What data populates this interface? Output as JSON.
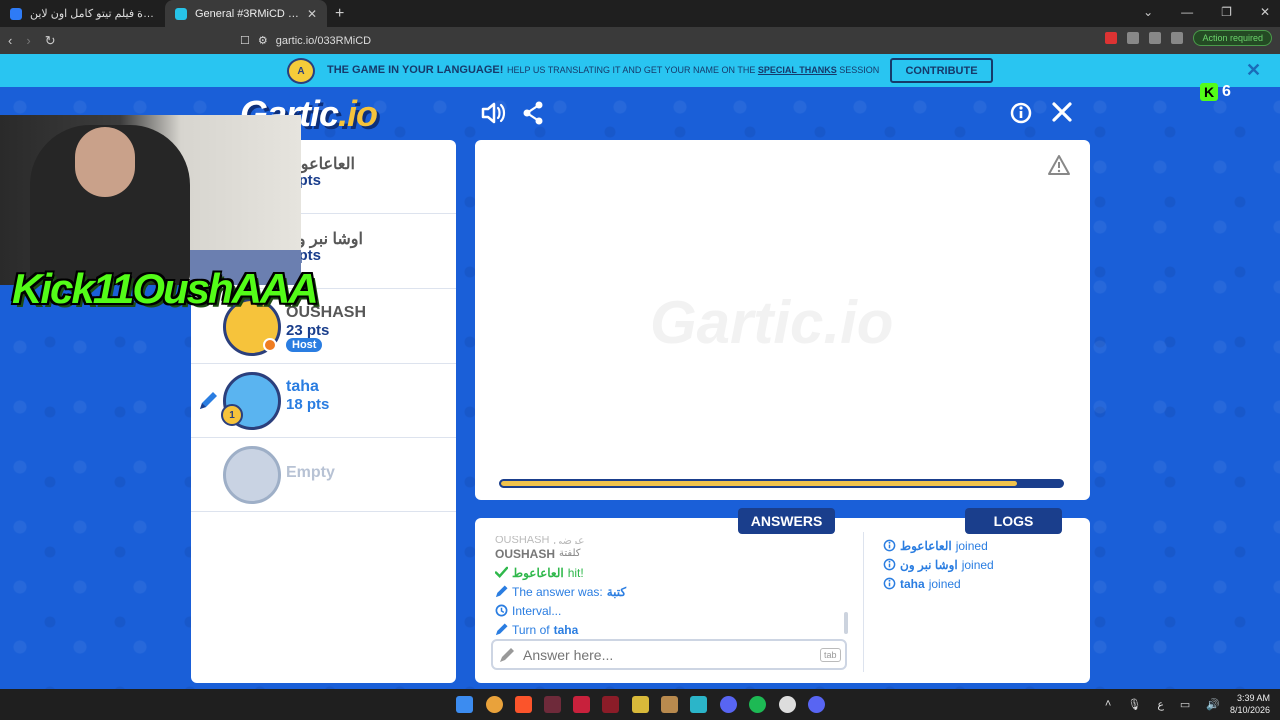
{
  "browser": {
    "tabs": [
      {
        "title": "مشاهدة فيلم تيتو كامل اون لاين HD"
      },
      {
        "title": "General #3RMiCD (العربية) - Gartic"
      }
    ],
    "url": "gartic.io/033RMiCD",
    "action_required": "Action required"
  },
  "banner": {
    "title": "THE GAME IN YOUR LANGUAGE!",
    "text_prefix": "HELP US TRANSLATING IT AND GET YOUR NAME ON THE",
    "special": "SPECIAL THANKS",
    "text_suffix": "SESSION",
    "contribute": "CONTRIBUTE",
    "close": "✕"
  },
  "header": {
    "logo_main": "Gartic",
    "logo_io": ".io",
    "kick_count": "6"
  },
  "overlay": {
    "kick_text": "Kick11OushAAA"
  },
  "players": [
    {
      "name": "العاعاعوط",
      "pts": "3 pts"
    },
    {
      "name": "اوشا نبر ون",
      "pts": "7 pts"
    },
    {
      "name": "OUSHASH",
      "pts": "23 pts",
      "badge": "Host"
    },
    {
      "name": "taha",
      "pts": "18 pts",
      "rank": "1"
    },
    {
      "name": "Empty"
    }
  ],
  "chat": {
    "answers_tab": "ANSWERS",
    "logs_tab": "LOGS",
    "answers": [
      {
        "type": "faded",
        "name": "OUSHASH",
        "text": "عرضي"
      },
      {
        "type": "gray",
        "name": "OUSHASH",
        "text": "كلفتة"
      },
      {
        "type": "green",
        "name": "العاعاعوط",
        "text": "hit!"
      },
      {
        "type": "pencil",
        "text": "The answer was:",
        "word": "كتبة"
      },
      {
        "type": "clock",
        "text": "Interval..."
      },
      {
        "type": "pencil",
        "text": "Turn of",
        "word": "taha"
      }
    ],
    "placeholder": "Answer here...",
    "tab_key": "tab",
    "logs": [
      {
        "name": "العاعاعوط",
        "text": "joined"
      },
      {
        "name": "اوشا نبر ون",
        "text": "joined"
      },
      {
        "name": "taha",
        "text": "joined"
      }
    ]
  },
  "canvas": {
    "watermark": "Gartic.io",
    "progress": 0.92
  },
  "taskbar": {
    "time": "3:39 AM",
    "date": "8/10/2026",
    "lang": "ع"
  },
  "colors": {
    "background": "#1a5fd8",
    "banner": "#29c5f1",
    "navy": "#1a3e8c",
    "accent_blue": "#2a7de1",
    "gold": "#f0c34c",
    "kick_green": "#53fc18"
  }
}
